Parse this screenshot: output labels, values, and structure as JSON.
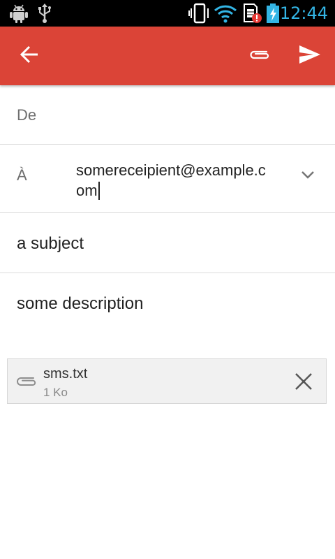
{
  "status_bar": {
    "time": "12:44",
    "icons": [
      "android-debug-icon",
      "usb-icon",
      "vibrate-icon",
      "wifi-icon",
      "sim-alert-icon",
      "battery-charging-icon"
    ]
  },
  "app_bar": {
    "color": "#db4437",
    "icons": [
      "back-arrow-icon",
      "attach-icon",
      "send-icon"
    ]
  },
  "compose": {
    "from_label": "De",
    "to_label": "À",
    "to_value": "somereceipient@example.com",
    "subject": "a subject",
    "body": "some description"
  },
  "attachment": {
    "name": "sms.txt",
    "size": "1 Ko",
    "icons": [
      "paperclip-icon",
      "close-icon"
    ]
  }
}
